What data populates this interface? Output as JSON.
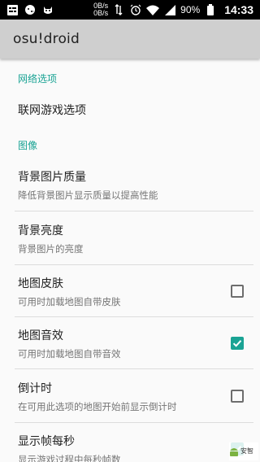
{
  "status_bar": {
    "net_down": "0B/s",
    "net_up": "0B/s",
    "battery": "90%",
    "time": "14:33",
    "icons": [
      "notification-grid-icon",
      "bird-icon",
      "cat-icon",
      "data-arrows-icon",
      "alarm-icon",
      "wifi-icon",
      "signal-icon",
      "battery-icon"
    ]
  },
  "app_bar": {
    "title": "osu!droid"
  },
  "sections": {
    "network": {
      "header": "网络选项",
      "online": {
        "title": "联网游戏选项"
      }
    },
    "graphics": {
      "header": "图像",
      "bg_quality": {
        "title": "背景图片质量",
        "summary": "降低背景图片显示质量以提高性能"
      },
      "bg_brightness": {
        "title": "背景亮度",
        "summary": "背景图片的亮度"
      },
      "skin": {
        "title": "地图皮肤",
        "summary": "可用时加载地图自带皮肤",
        "checked": false
      },
      "sound": {
        "title": "地图音效",
        "summary": "可用时加载地图自带音效",
        "checked": true
      },
      "countdown": {
        "title": "倒计时",
        "summary": "在可用此选项的地图开始前显示倒计时",
        "checked": false
      },
      "fps": {
        "title": "显示帧每秒",
        "summary": "显示游戏过程中每秒帧数",
        "checked": true
      }
    }
  },
  "watermark": {
    "line1": "安智"
  },
  "colors": {
    "accent": "#1aa394",
    "app_bar": "#cfcfcf",
    "background": "#fafafa"
  }
}
